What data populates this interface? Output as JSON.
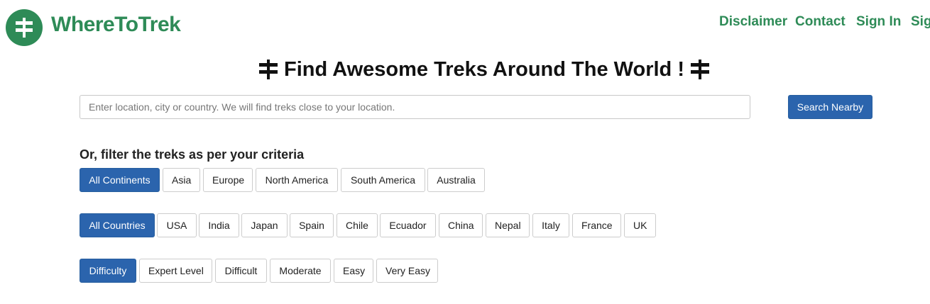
{
  "brand": {
    "name": "WhereToTrek",
    "logo_icon": "signpost-icon",
    "color": "#2e8b57"
  },
  "nav": {
    "items": [
      {
        "label": "Disclaimer"
      },
      {
        "label": "Contact"
      },
      {
        "label": "Sign In"
      },
      {
        "label": "Sig"
      }
    ]
  },
  "hero": {
    "title": "Find Awesome Treks Around The World !",
    "icon": "signpost-icon"
  },
  "search": {
    "placeholder": "Enter location, city or country. We will find treks close to your location.",
    "value": "",
    "button_label": "Search Nearby"
  },
  "filters": {
    "title": "Or, filter the treks as per your criteria",
    "continents": [
      {
        "label": "All Continents",
        "active": true
      },
      {
        "label": "Asia",
        "active": false
      },
      {
        "label": "Europe",
        "active": false
      },
      {
        "label": "North America",
        "active": false
      },
      {
        "label": "South America",
        "active": false
      },
      {
        "label": "Australia",
        "active": false
      }
    ],
    "countries": [
      {
        "label": "All Countries",
        "active": true
      },
      {
        "label": "USA",
        "active": false
      },
      {
        "label": "India",
        "active": false
      },
      {
        "label": "Japan",
        "active": false
      },
      {
        "label": "Spain",
        "active": false
      },
      {
        "label": "Chile",
        "active": false
      },
      {
        "label": "Ecuador",
        "active": false
      },
      {
        "label": "China",
        "active": false
      },
      {
        "label": "Nepal",
        "active": false
      },
      {
        "label": "Italy",
        "active": false
      },
      {
        "label": "France",
        "active": false
      },
      {
        "label": "UK",
        "active": false
      }
    ],
    "difficulty": [
      {
        "label": "Difficulty",
        "active": true
      },
      {
        "label": "Expert Level",
        "active": false
      },
      {
        "label": "Difficult",
        "active": false
      },
      {
        "label": "Moderate",
        "active": false
      },
      {
        "label": "Easy",
        "active": false
      },
      {
        "label": "Very Easy",
        "active": false
      }
    ]
  },
  "colors": {
    "accent": "#2e8b57",
    "primary_button": "#2b64ad"
  }
}
